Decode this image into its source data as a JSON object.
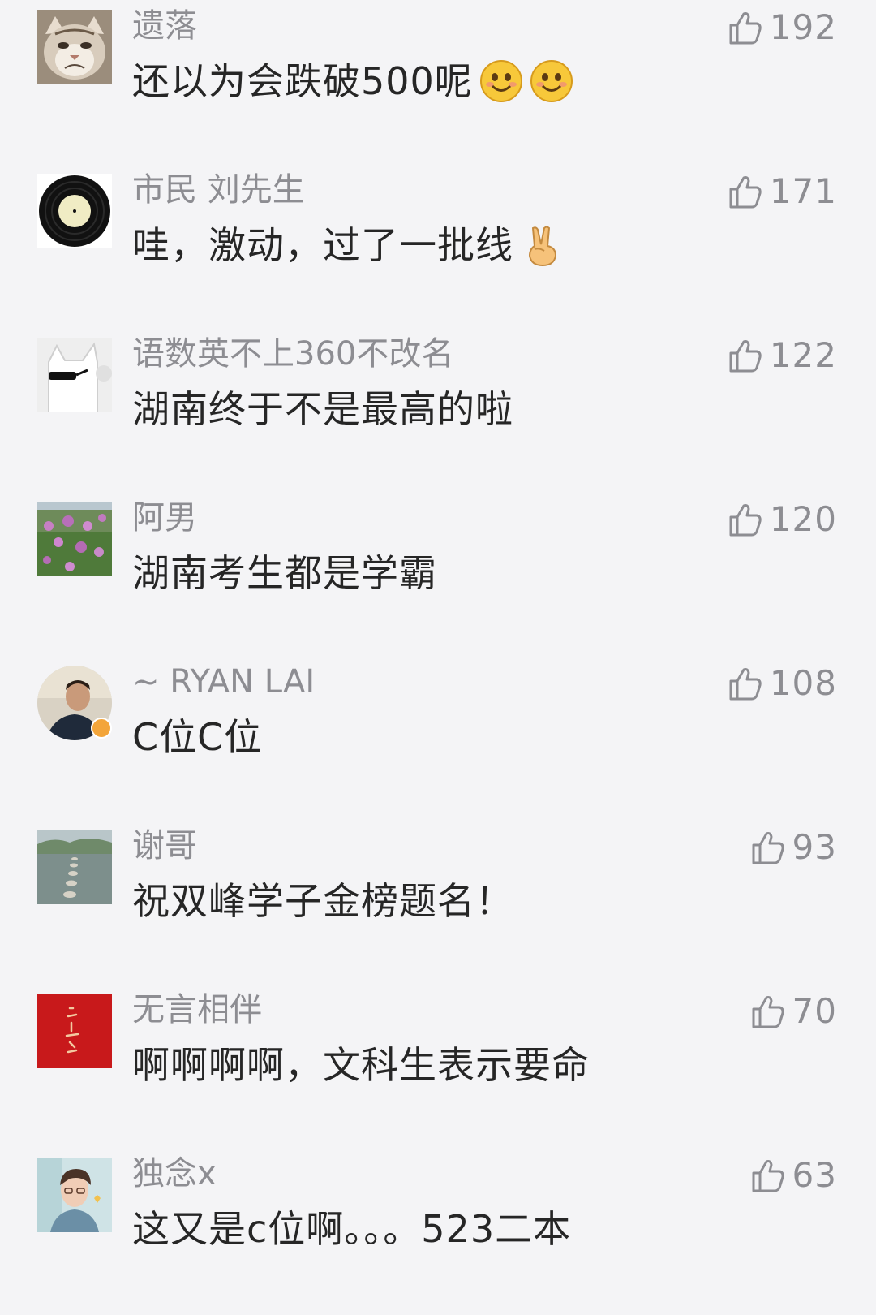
{
  "comments": [
    {
      "username": "遗落",
      "text": "还以为会跌破500呢",
      "likes": "192",
      "avatar": "grumpy-cat-icon",
      "emojis": [
        "smile-emoji-icon",
        "smile-emoji-icon"
      ]
    },
    {
      "username": "市民 刘先生",
      "text": "哇，激动，过了一批线",
      "likes": "171",
      "avatar": "vinyl-record-icon",
      "emojis": [
        "victory-hand-emoji-icon"
      ]
    },
    {
      "username": "语数英不上360不改名",
      "text": "湖南终于不是最高的啦",
      "likes": "122",
      "avatar": "cool-dog-sunglasses-icon",
      "emojis": []
    },
    {
      "username": "阿男",
      "text": "湖南考生都是学霸",
      "likes": "120",
      "avatar": "flower-field-photo",
      "emojis": []
    },
    {
      "username": "~ RYAN LAI",
      "text": "C位C位",
      "likes": "108",
      "avatar": "man-portrait-photo",
      "emojis": []
    },
    {
      "username": "谢哥",
      "text": "祝双峰学子金榜题名！",
      "likes": "93",
      "avatar": "river-stepping-stones-photo",
      "emojis": []
    },
    {
      "username": "无言相伴",
      "text": "啊啊啊啊，文科生表示要命",
      "likes": "70",
      "avatar": "red-calligraphy-icon",
      "emojis": []
    },
    {
      "username": "独念x",
      "text": "这又是c位啊。。。523二本",
      "likes": "63",
      "avatar": "young-man-portrait-photo",
      "emojis": []
    }
  ],
  "colors": {
    "background": "#f4f4f6",
    "username": "#8d8d92",
    "text": "#262626",
    "like": "#8d8d92"
  }
}
